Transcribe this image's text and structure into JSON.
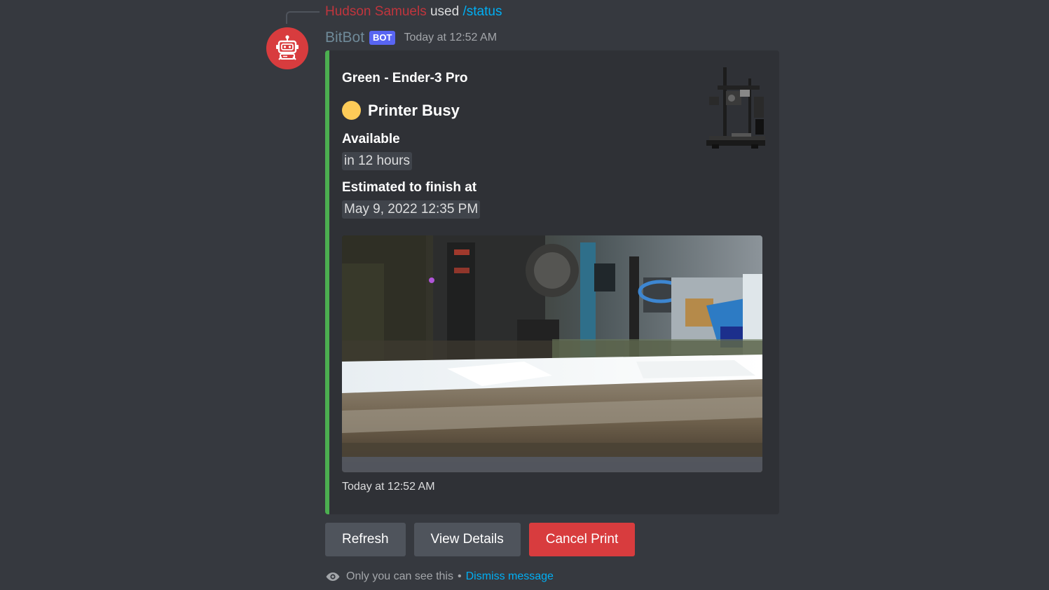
{
  "reply": {
    "user": "Hudson Samuels",
    "used": "used",
    "command": "/status"
  },
  "message": {
    "author": "BitBot",
    "bot_tag": "BOT",
    "timestamp": "Today at 12:52 AM"
  },
  "embed": {
    "title": "Green - Ender-3 Pro",
    "status": "Printer Busy",
    "status_color": "#fdcb58",
    "accent_color": "#4caf50",
    "fields": [
      {
        "name": "Available",
        "value": "in 12 hours"
      },
      {
        "name": "Estimated to finish at",
        "value": "May 9, 2022 12:35 PM"
      }
    ],
    "footer": "Today at 12:52 AM"
  },
  "buttons": {
    "refresh": "Refresh",
    "view_details": "View Details",
    "cancel_print": "Cancel Print"
  },
  "ephemeral": {
    "note": "Only you can see this",
    "separator": "•",
    "dismiss": "Dismiss message"
  },
  "icons": {
    "reply": "eye-icon",
    "avatar": "robot-icon"
  }
}
